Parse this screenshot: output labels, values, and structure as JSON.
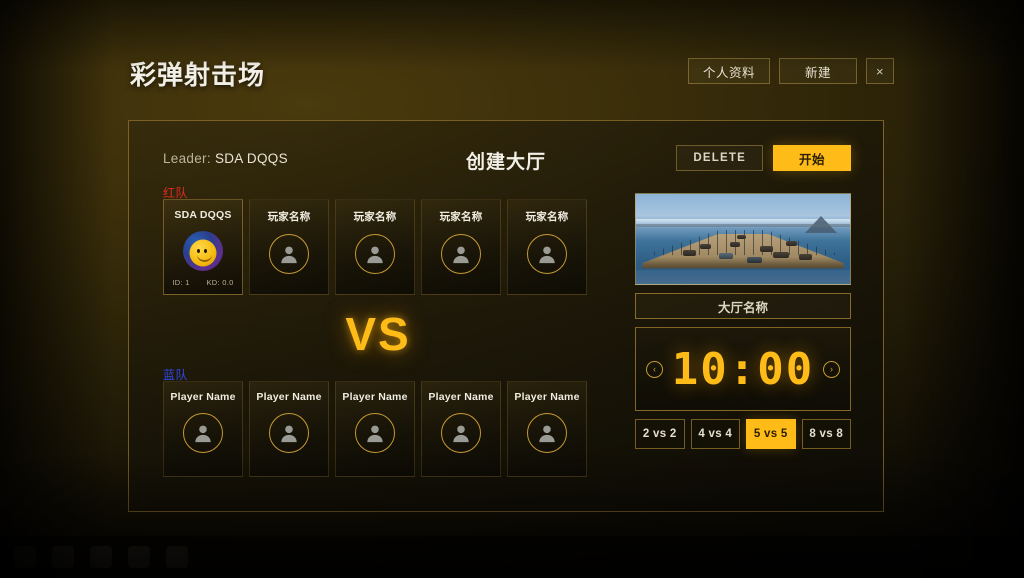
{
  "app": {
    "title": "彩弹射击场"
  },
  "topbar": {
    "profile_label": "个人资料",
    "new_label": "新建",
    "close_label": "×"
  },
  "lobby": {
    "leader_prefix": "Leader:",
    "leader_name": "SDA DQQS",
    "heading": "创建大厅",
    "delete_label": "DELETE",
    "start_label": "开始",
    "vs_label": "VS"
  },
  "teams": {
    "red": {
      "label": "红队",
      "color": "#e02b20",
      "slots": [
        {
          "name": "SDA DQQS",
          "filled": true,
          "id_label": "ID: 1",
          "kd_label": "KD: 0.0"
        },
        {
          "name": "玩家名称",
          "filled": false
        },
        {
          "name": "玩家名称",
          "filled": false
        },
        {
          "name": "玩家名称",
          "filled": false
        },
        {
          "name": "玩家名称",
          "filled": false
        }
      ]
    },
    "blue": {
      "label": "蓝队",
      "color": "#2f49e8",
      "slots": [
        {
          "name": "Player Name",
          "filled": false
        },
        {
          "name": "Player Name",
          "filled": false
        },
        {
          "name": "Player Name",
          "filled": false
        },
        {
          "name": "Player Name",
          "filled": false
        },
        {
          "name": "Player Name",
          "filled": false
        }
      ]
    }
  },
  "settings": {
    "map_preview_alt": "map-preview",
    "lobby_name_value": "大厅名称",
    "timer_value": "10:00",
    "timer_prev_label": "‹",
    "timer_next_label": "›",
    "modes": [
      {
        "label": "2 vs 2",
        "active": false
      },
      {
        "label": "4 vs 4",
        "active": false
      },
      {
        "label": "5 vs 5",
        "active": true
      },
      {
        "label": "8 vs 8",
        "active": false
      }
    ]
  },
  "theme": {
    "accent": "#ffbb17",
    "border": "#c69a32",
    "background": "#241d07"
  },
  "taskbar": {
    "icons": [
      "app-icon-1",
      "app-icon-2",
      "app-icon-3",
      "app-icon-4",
      "app-icon-5"
    ]
  }
}
